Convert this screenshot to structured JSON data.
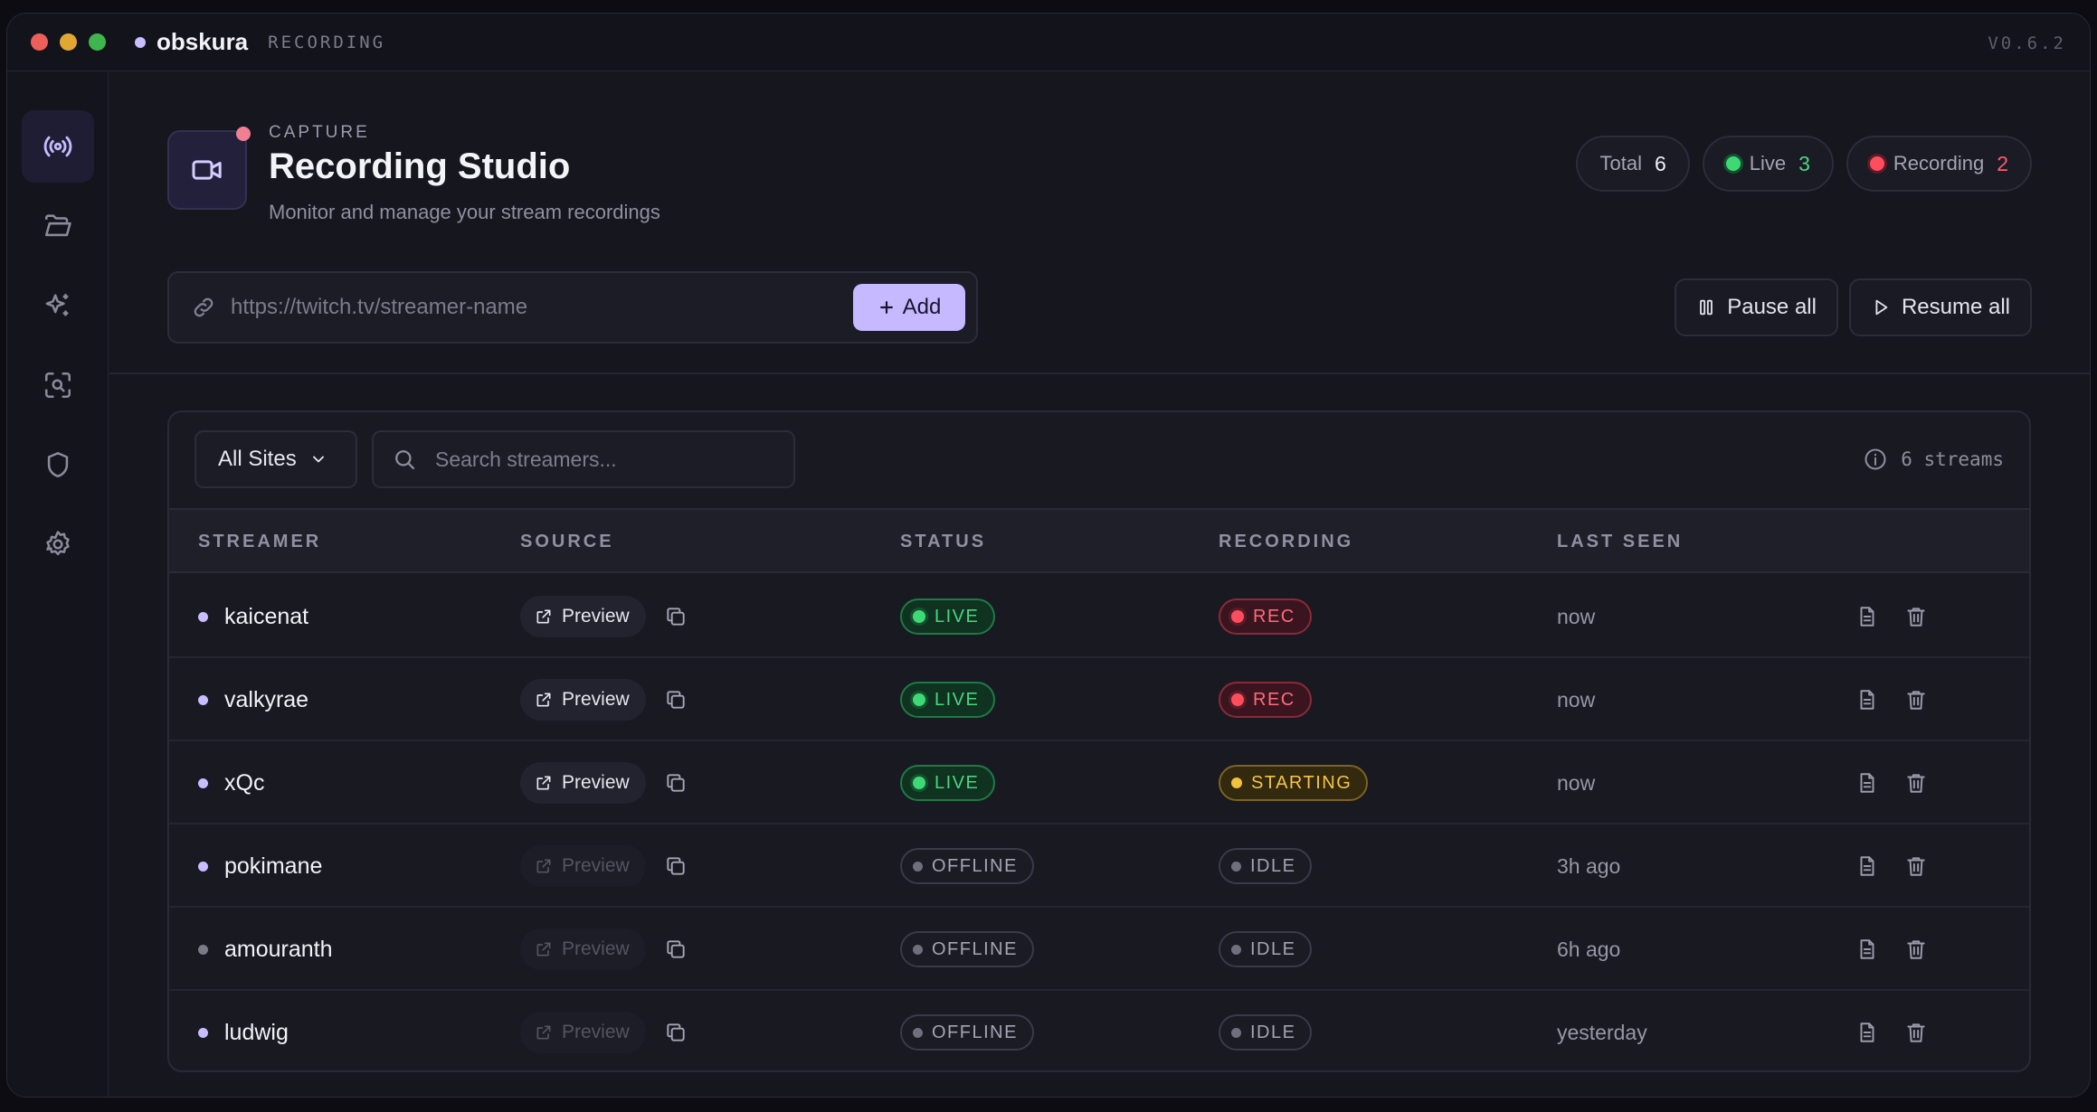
{
  "titlebar": {
    "brand": "obskura",
    "section": "RECORDING",
    "version": "V0.6.2"
  },
  "sidebar": {
    "items": [
      {
        "icon": "broadcast-icon",
        "active": true
      },
      {
        "icon": "folder-icon",
        "active": false
      },
      {
        "icon": "sparkles-icon",
        "active": false
      },
      {
        "icon": "scan-search-icon",
        "active": false
      },
      {
        "icon": "shield-icon",
        "active": false
      },
      {
        "icon": "gear-icon",
        "active": false
      }
    ]
  },
  "header": {
    "eyebrow": "CAPTURE",
    "title": "Recording Studio",
    "subtitle": "Monitor and manage your stream recordings",
    "stats": {
      "total_label": "Total",
      "total_value": "6",
      "live_label": "Live",
      "live_value": "3",
      "recording_label": "Recording",
      "recording_value": "2"
    },
    "url_placeholder": "https://twitch.tv/streamer-name",
    "add_label": "Add",
    "pause_label": "Pause all",
    "resume_label": "Resume all"
  },
  "colors": {
    "accent": "#c6b9ff",
    "live": "#4ad67e",
    "rec": "#ff6a78",
    "starting": "#f5c542"
  },
  "filters": {
    "site_select": "All Sites",
    "search_placeholder": "Search streamers...",
    "stream_count": "6 streams"
  },
  "table": {
    "columns": [
      "STREAMER",
      "SOURCE",
      "STATUS",
      "RECORDING",
      "LAST SEEN"
    ],
    "rows": [
      {
        "name": "kaicenat",
        "preview": "Preview",
        "status": "LIVE",
        "recording": "REC",
        "last_seen": "now"
      },
      {
        "name": "valkyrae",
        "preview": "Preview",
        "status": "LIVE",
        "recording": "REC",
        "last_seen": "now"
      },
      {
        "name": "xQc",
        "preview": "Preview",
        "status": "LIVE",
        "recording": "STARTING",
        "last_seen": "now"
      },
      {
        "name": "pokimane",
        "preview": "Preview",
        "status": "OFFLINE",
        "recording": "IDLE",
        "last_seen": "3h ago"
      },
      {
        "name": "amouranth",
        "preview": "Preview",
        "status": "OFFLINE",
        "recording": "IDLE",
        "last_seen": "6h ago"
      },
      {
        "name": "ludwig",
        "preview": "Preview",
        "status": "OFFLINE",
        "recording": "IDLE",
        "last_seen": "yesterday"
      }
    ]
  }
}
